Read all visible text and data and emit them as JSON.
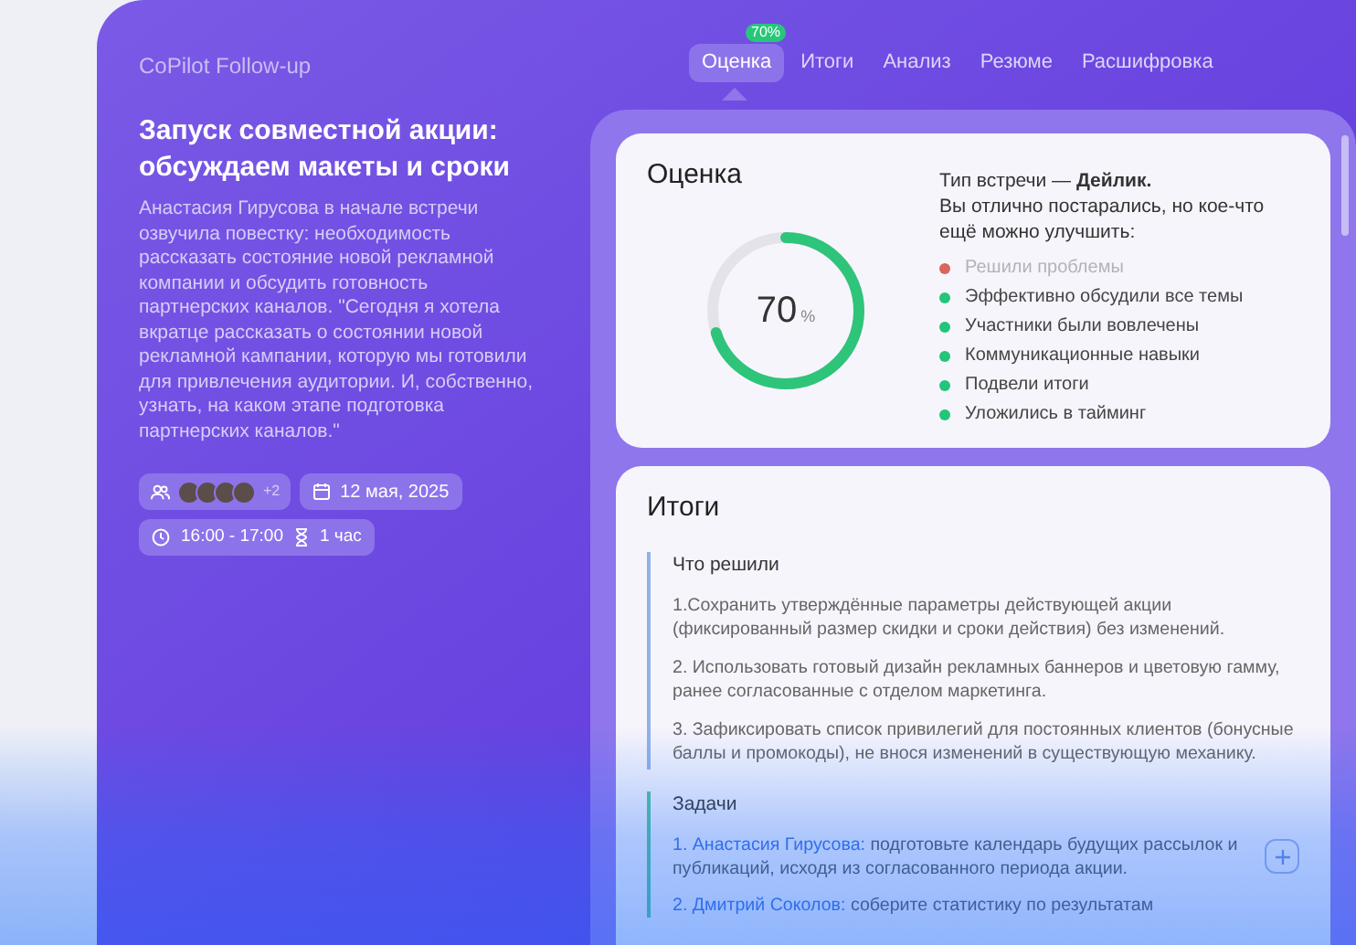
{
  "app_title": "CoPilot Follow-up",
  "tabs": [
    {
      "label": "Оценка",
      "selected": true,
      "badge": "70%"
    },
    {
      "label": "Итоги",
      "selected": false
    },
    {
      "label": "Анализ",
      "selected": false
    },
    {
      "label": "Резюме",
      "selected": false
    },
    {
      "label": "Расшифровка",
      "selected": false
    }
  ],
  "meeting": {
    "title": "Запуск совместной акции: обсуждаем макеты и сроки",
    "summary": "Анастасия Гирусова в начале встречи озвучила повестку: необходимость рассказать состояние новой рекламной компании и обсудить готовность партнерских каналов. \"Сегодня я хотела вкратце рассказать о состоянии новой рекламной кампании, которую мы готовили для привлечения аудитории. И, собственно, узнать, на каком этапе подготовка партнерских каналов.\"",
    "participants_extra": "+2",
    "date": "12 мая, 2025",
    "time": "16:00 - 17:00",
    "duration": "1 час"
  },
  "score_card": {
    "title": "Оценка",
    "percent": "70",
    "percent_sign": "%",
    "level": 0.7,
    "meeting_type": "Тип встречи — **Дейлик.**",
    "message": "Вы отлично постарались, но кое-что ещё можно улучшить:",
    "criteria": [
      {
        "label": "Решили проблемы",
        "done": false
      },
      {
        "label": "Эффективно обсудили все темы",
        "done": true
      },
      {
        "label": "Участники были вовлечены",
        "done": true
      },
      {
        "label": "Коммуникационные навыки",
        "done": true
      },
      {
        "label": "Подвели итоги",
        "done": true
      },
      {
        "label": "Уложились в тайминг",
        "done": true
      }
    ]
  },
  "results_card": {
    "title": "Итоги",
    "decisions": {
      "heading": "Что решили",
      "items": [
        "1.Сохранить утверждённые параметры действующей акции (фиксированный размер скидки и сроки действия) без изменений.",
        "2. Использовать готовый дизайн рекламных баннеров и цветовую гамму, ранее согласованные с отделом маркетинга.",
        "3. Зафиксировать список привилегий для постоянных клиентов (бонусные баллы и промокоды), не внося изменений в существующую механику."
      ]
    },
    "tasks": {
      "heading": "Задачи",
      "items": [
        {
          "assignee": "1. Анастасия Гирусова:",
          "text": "подготовьте календарь будущих рассылок и публикаций, исходя из согласованного периода акции."
        },
        {
          "assignee": "2. Дмитрий Соколов:",
          "text": "соберите статистику по результатам"
        }
      ]
    }
  }
}
